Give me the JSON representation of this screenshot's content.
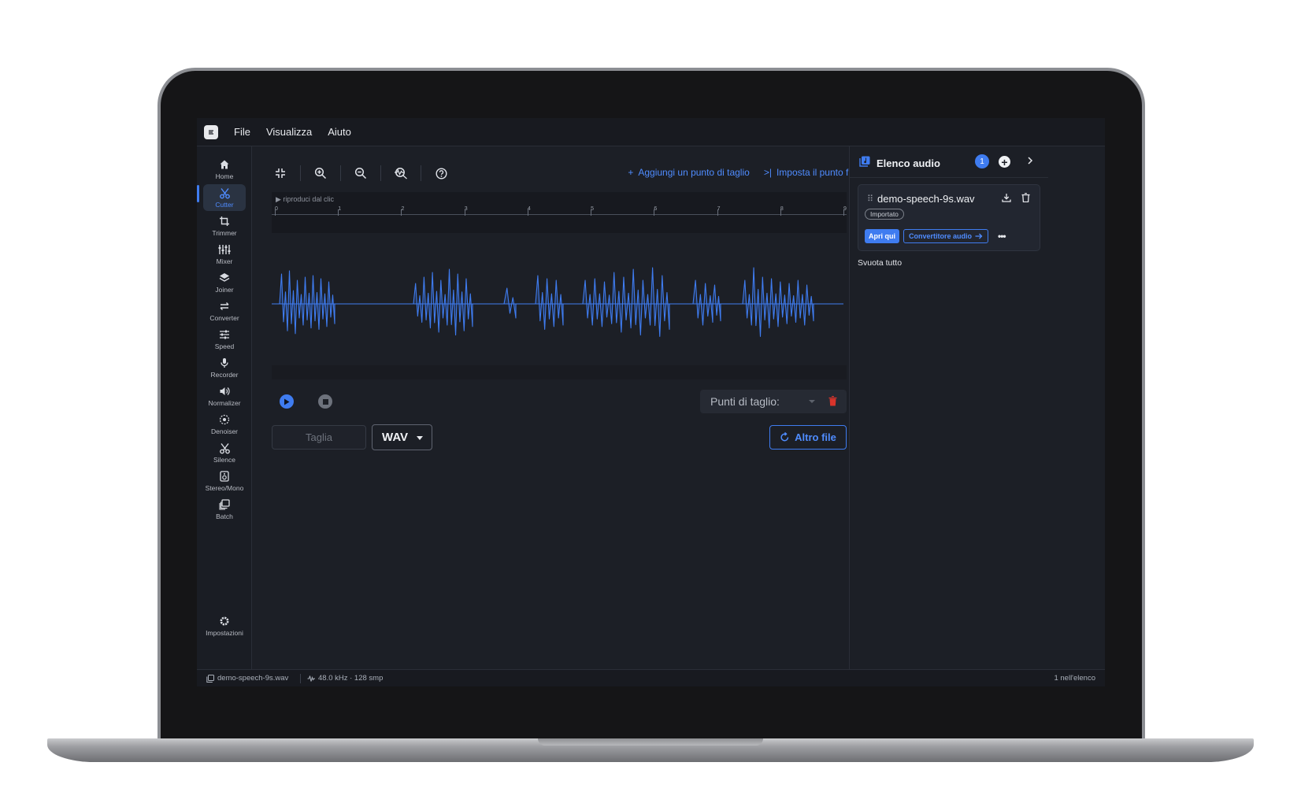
{
  "menu": {
    "items": [
      "File",
      "Visualizza",
      "Aiuto"
    ]
  },
  "sidebar": {
    "items": [
      {
        "label": "Home",
        "icon": "home-icon",
        "active": false
      },
      {
        "label": "Cutter",
        "icon": "scissors-icon",
        "active": true
      },
      {
        "label": "Trimmer",
        "icon": "crop-icon",
        "active": false
      },
      {
        "label": "Mixer",
        "icon": "sliders-icon",
        "active": false
      },
      {
        "label": "Joiner",
        "icon": "layers-icon",
        "active": false
      },
      {
        "label": "Converter",
        "icon": "swap-icon",
        "active": false
      },
      {
        "label": "Speed",
        "icon": "tune-icon",
        "active": false
      },
      {
        "label": "Recorder",
        "icon": "microphone-icon",
        "active": false
      },
      {
        "label": "Normalizer",
        "icon": "speaker-icon",
        "active": false
      },
      {
        "label": "Denoiser",
        "icon": "denoise-icon",
        "active": false
      },
      {
        "label": "Silence",
        "icon": "scissors-icon",
        "active": false
      },
      {
        "label": "Stereo/Mono",
        "icon": "stereo-icon",
        "active": false
      },
      {
        "label": "Batch",
        "icon": "batch-icon",
        "active": false
      }
    ],
    "settings_label": "Impostazioni"
  },
  "toolbar": {
    "add_cut_label": "Aggiungi un punto di taglio",
    "set_end_label": "Imposta il punto final"
  },
  "timeline": {
    "play_hint": "▶ riproduci dal clic",
    "ticks": [
      "0",
      "1",
      "2",
      "3",
      "4",
      "5",
      "6",
      "7",
      "8",
      "9"
    ]
  },
  "controls": {
    "cut_points_label": "Punti di taglio:",
    "cut_button": "Taglia",
    "format": "WAV",
    "other_file": "Altro file"
  },
  "panel": {
    "title": "Elenco audio",
    "count": "1",
    "file": {
      "name": "demo-speech-9s.wav",
      "status": "Importato",
      "open_here": "Apri qui",
      "converter": "Convertitore audio"
    },
    "clear_all": "Svuota tutto"
  },
  "status": {
    "file": "demo-speech-9s.wav",
    "rate": "48.0 kHz · 128 smp",
    "count": "1 nell'elenco"
  },
  "colors": {
    "accent": "#3f7cf0",
    "waveform": "#3f7cf0",
    "background": "#1c1f26",
    "danger": "#d9342b"
  }
}
